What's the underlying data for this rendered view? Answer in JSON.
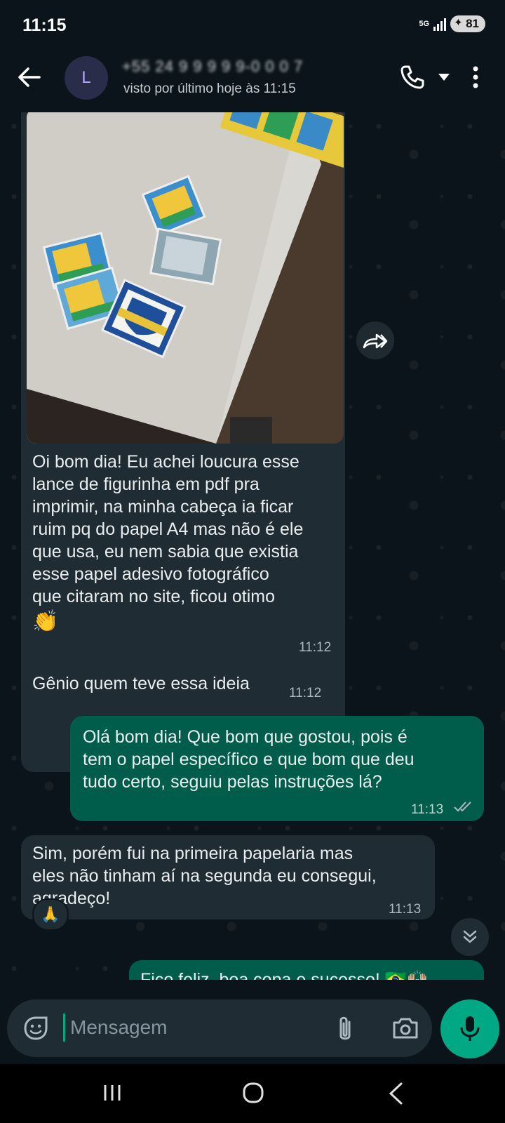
{
  "status_bar": {
    "time": "11:15",
    "network_type": "5G",
    "battery": "81"
  },
  "header": {
    "avatar_letter": "L",
    "contact_name": "+55 24 9 9 9 9 9-0 0 0 7",
    "last_seen": "visto por último hoje às 11:15"
  },
  "messages": [
    {
      "direction": "in",
      "type": "image",
      "text": "Oi bom dia! Eu achei loucura esse lance de figurinha em pdf pra imprimir, na minha cabeça ia ficar ruim pq do papel A4 mas não é ele que usa, eu nem sabia que existia esse papel adesivo fotográfico que citaram no site, ficou otimo",
      "lines": [
        "Oi bom dia! Eu achei loucura esse",
        "lance de figurinha em pdf pra",
        "imprimir, na minha cabeça ia ficar",
        "ruim pq do papel A4 mas não é ele",
        "que usa, eu nem sabia que existia",
        "esse papel adesivo fotográfico",
        "que citaram no site, ficou otimo"
      ],
      "emoji": "👏",
      "time": "11:12"
    },
    {
      "direction": "in",
      "type": "text",
      "text": "Gênio quem teve essa ideia",
      "time": "11:12"
    },
    {
      "direction": "out",
      "type": "text",
      "lines": [
        "Olá bom dia! Que bom que gostou, pois é",
        "tem o papel específico e que bom que deu",
        "tudo certo, seguiu pelas instruções lá?"
      ],
      "time": "11:13",
      "status": "read"
    },
    {
      "direction": "in",
      "type": "text",
      "lines": [
        "Sim, porém fui na primeira papelaria mas",
        "eles não tinham aí na segunda eu consegui,",
        "agradeço!"
      ],
      "time": "11:13",
      "reaction": "🙏"
    },
    {
      "direction": "out",
      "type": "text",
      "text": "Fico feliz, boa copa e sucesso! 🇧🇷🙌🏼"
    }
  ],
  "input": {
    "placeholder": "Mensagem"
  },
  "colors": {
    "background": "#0b141a",
    "incoming_bubble": "#202c33",
    "outgoing_bubble": "#005c4b",
    "accent": "#00a884"
  }
}
